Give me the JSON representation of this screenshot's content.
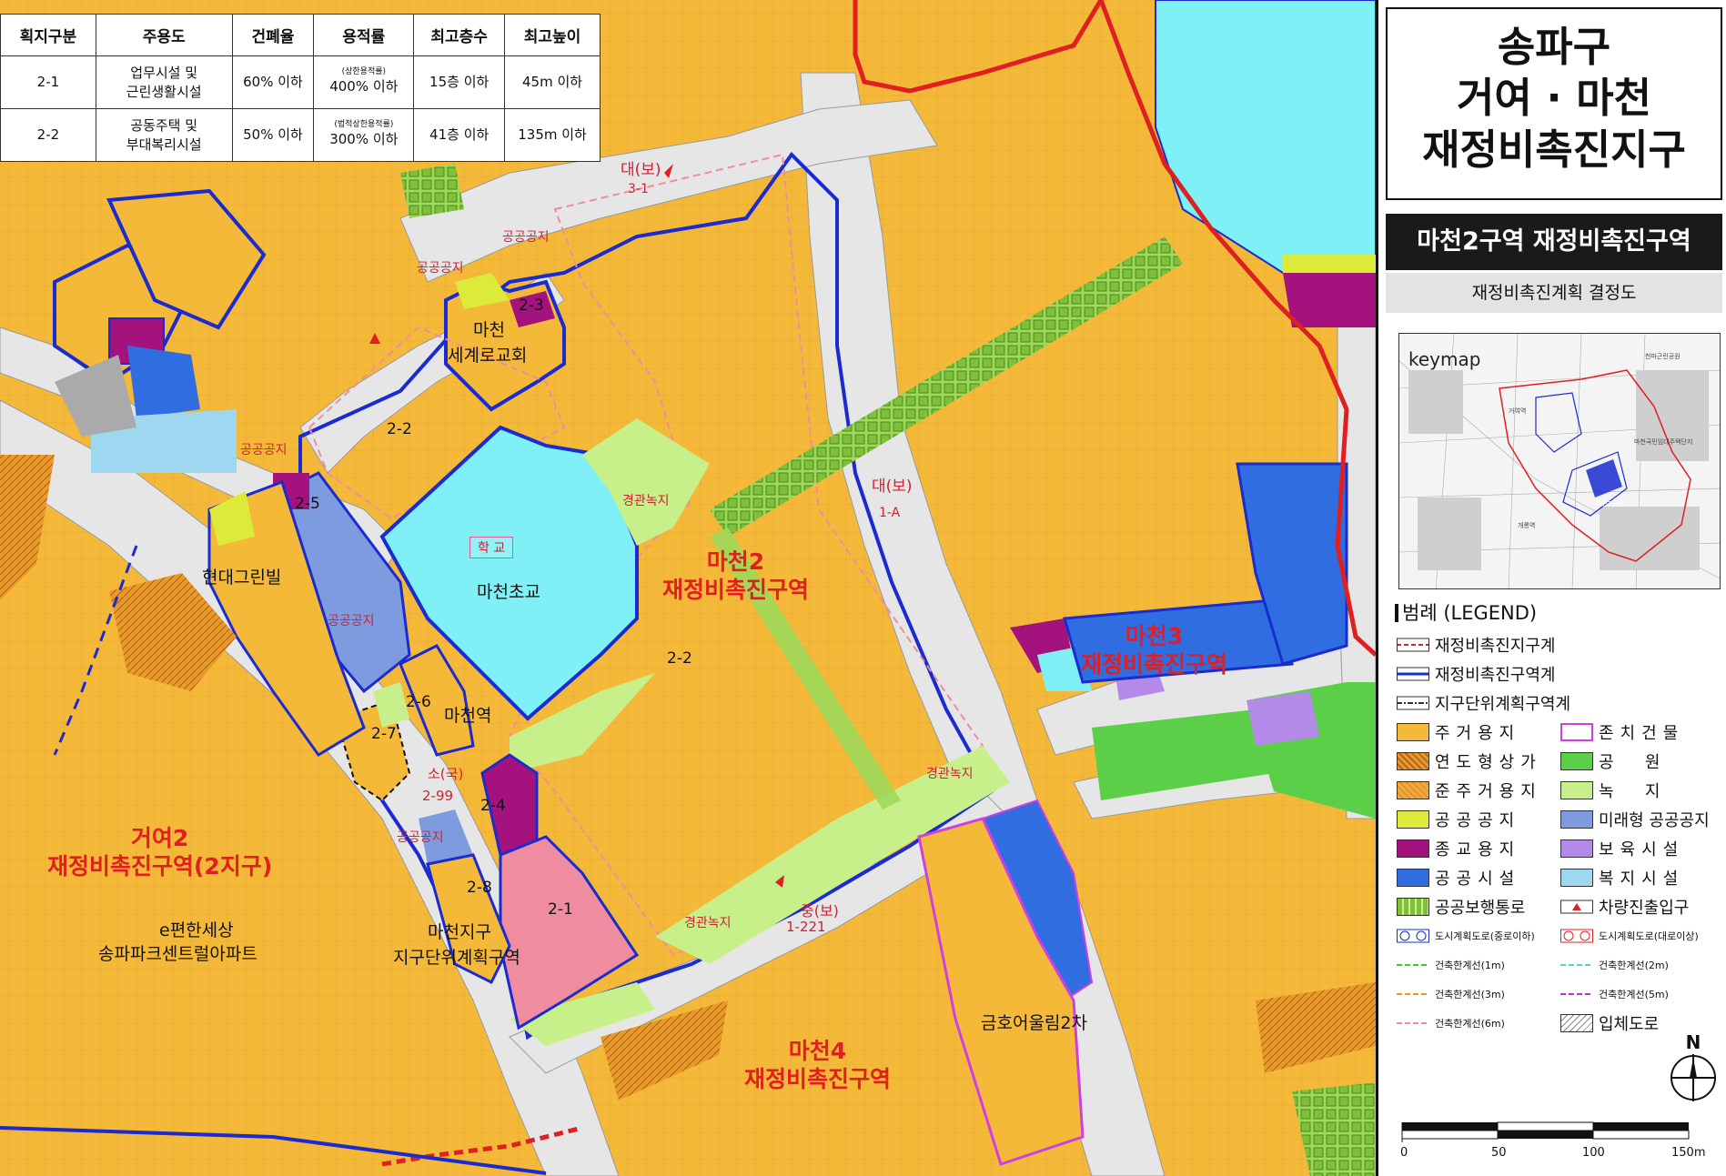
{
  "table": {
    "headers": [
      "획지구분",
      "주용도",
      "건폐율",
      "용적률",
      "최고층수",
      "최고높이"
    ],
    "rows": [
      {
        "lot": "2-1",
        "use": "업무시설 및\n근린생활시설",
        "coverage": "60% 이하",
        "far_note": "(상한용적률)",
        "far": "400% 이하",
        "floors": "15층 이하",
        "height": "45m 이하"
      },
      {
        "lot": "2-2",
        "use": "공동주택 및\n부대복리시설",
        "coverage": "50% 이하",
        "far_note": "(법적상한용적률)",
        "far": "300% 이하",
        "floors": "41층 이하",
        "height": "135m 이하"
      }
    ]
  },
  "map_labels": {
    "zone_2_2_a": "2-2",
    "zone_2_2_b": "2-2",
    "zone_2_1": "2-1",
    "zone_2_3": "2-3",
    "zone_2_4": "2-4",
    "zone_2_5": "2-5",
    "zone_2_6": "2-6",
    "zone_2_7": "2-7",
    "zone_2_8": "2-8",
    "church_1": "마천",
    "church_2": "세계로교회",
    "school_box": "학      교",
    "school": "마천초교",
    "hyundai": "현대그린빌",
    "station": "마천역",
    "apt_1": "e편한세상",
    "apt_2": "송파파크센트럴아파트",
    "jigu_1": "마천지구",
    "jigu_2": "지구단위계획구역",
    "kumho": "금호어울림2차",
    "machon2_1": "마천2",
    "machon2_2": "재정비촉진구역",
    "machon3_1": "마천3",
    "machon3_2": "재정비촉진구역",
    "machon4_1": "마천4",
    "machon4_2": "재정비촉진구역",
    "geoyeo2_1": "거여2",
    "geoyeo2_2": "재정비촉진구역(2지구)",
    "public_space_1": "공공공지",
    "public_space_2": "공공공지",
    "public_space_3": "공공공지",
    "public_space_4": "공공공지",
    "public_space_5": "공공공지",
    "green_1": "경관녹지",
    "green_2": "경관녹지",
    "green_3": "경관녹지",
    "road_dae1": "대(보)",
    "road_dae1_no": "3-1",
    "road_dae2": "대(보)",
    "road_dae2_no": "1-A",
    "road_jung": "중(보)",
    "road_jung_no": "1-221",
    "road_so": "소(국)",
    "road_so_no": "2-99"
  },
  "panel": {
    "title_1": "송파구",
    "title_2": "거여 · 마천",
    "title_3": "재정비촉진지구",
    "district": "마천2구역 재정비촉진구역",
    "plan": "재정비촉진계획 결정도",
    "keymap_title": "keymap",
    "keymap_note_1": "천마근린공원",
    "keymap_note_2": "마천국민임대주택단지",
    "keymap_note_3": "마천2구역",
    "keymap_note_4": "거여역",
    "keymap_note_5": "개롱역",
    "legend_title": "범례 (LEGEND)",
    "legend": {
      "l1": "재정비촉진지구계",
      "l2": "재정비촉진구역계",
      "l3": "지구단위계획구역계",
      "a1": "주거용지",
      "a2": "연도형상가",
      "a3": "준주거용지",
      "a4": "공공공지",
      "a5": "종교용지",
      "a6": "공공시설",
      "a7": "공공보행통로",
      "a8": "도시계획도로(중로이하)",
      "a9": "건축한계선(1m)",
      "a10": "건축한계선(3m)",
      "a11": "건축한계선(6m)",
      "b1": "존치건물",
      "b2": "공      원",
      "b3": "녹      지",
      "b4": "미래형 공공공지",
      "b5": "보육시설",
      "b6": "복지시설",
      "b7": "차량진출입구",
      "b8": "도시계획도로(대로이상)",
      "b9": "건축한계선(2m)",
      "b10": "건축한계선(5m)",
      "b11": "입체도로"
    },
    "north": "N",
    "scale": [
      "0",
      "50",
      "100",
      "150m"
    ]
  },
  "colors": {
    "residential": "#f5b93a",
    "road": "#e6e6e6",
    "school": "#7ff0f5",
    "religion": "#a4127e",
    "public_facility": "#2f6de0",
    "green": "#c8f08a",
    "park": "#5ccf48",
    "future_public": "#7f9be0",
    "pink_commercial": "#f08ca0",
    "district_boundary": "#e02020",
    "zone_boundary": "#1a2bd0"
  }
}
